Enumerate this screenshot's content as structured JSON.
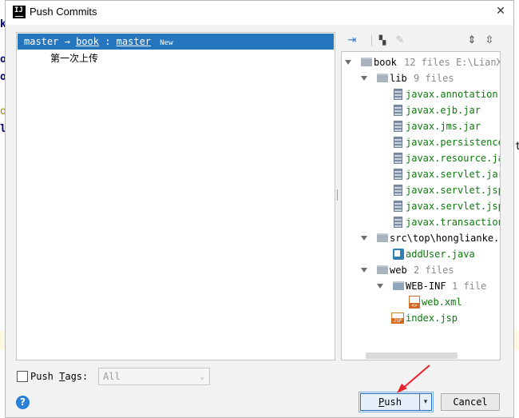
{
  "dialog": {
    "title": "Push Commits",
    "close_glyph": "✕"
  },
  "background": {
    "chars": [
      "k",
      "o",
      "o",
      "o",
      "l"
    ],
    "right_chars": [
      "st",
      "t"
    ]
  },
  "commits": {
    "branch_local": "master",
    "arrow": "→",
    "remote": "book",
    "separator": ":",
    "branch_remote": "master",
    "new_tag": "New",
    "commit_message": "第一次上传"
  },
  "tree": {
    "root": {
      "name": "book",
      "meta": "12 files  E:\\LianX"
    },
    "lib": {
      "name": "lib",
      "meta": "9 files"
    },
    "jars": [
      "javax.annotation.",
      "javax.ejb.jar",
      "javax.jms.jar",
      "javax.persistence",
      "javax.resource.ja",
      "javax.servlet.jar",
      "javax.servlet.jsp",
      "javax.servlet.jsp",
      "javax.transaction"
    ],
    "src": {
      "name": "src\\top\\honglianke.ji"
    },
    "src_file": "addUser.java",
    "web": {
      "name": "web",
      "meta": "2 files"
    },
    "webinf": {
      "name": "WEB-INF",
      "meta": "1 file"
    },
    "webinf_file": "web.xml",
    "web_file": "index.jsp"
  },
  "bottom": {
    "push_tags_label_pre": "Push ",
    "push_tags_label_u": "T",
    "push_tags_label_post": "ags:",
    "tags_select_value": "All",
    "help_glyph": "?",
    "push_label_u": "P",
    "push_label_rest": "ush",
    "cancel_label": "Cancel"
  },
  "colors": {
    "selection": "#2675bf",
    "jar_text": "#0b7a0b",
    "arrow_annotation": "#e8242a"
  }
}
